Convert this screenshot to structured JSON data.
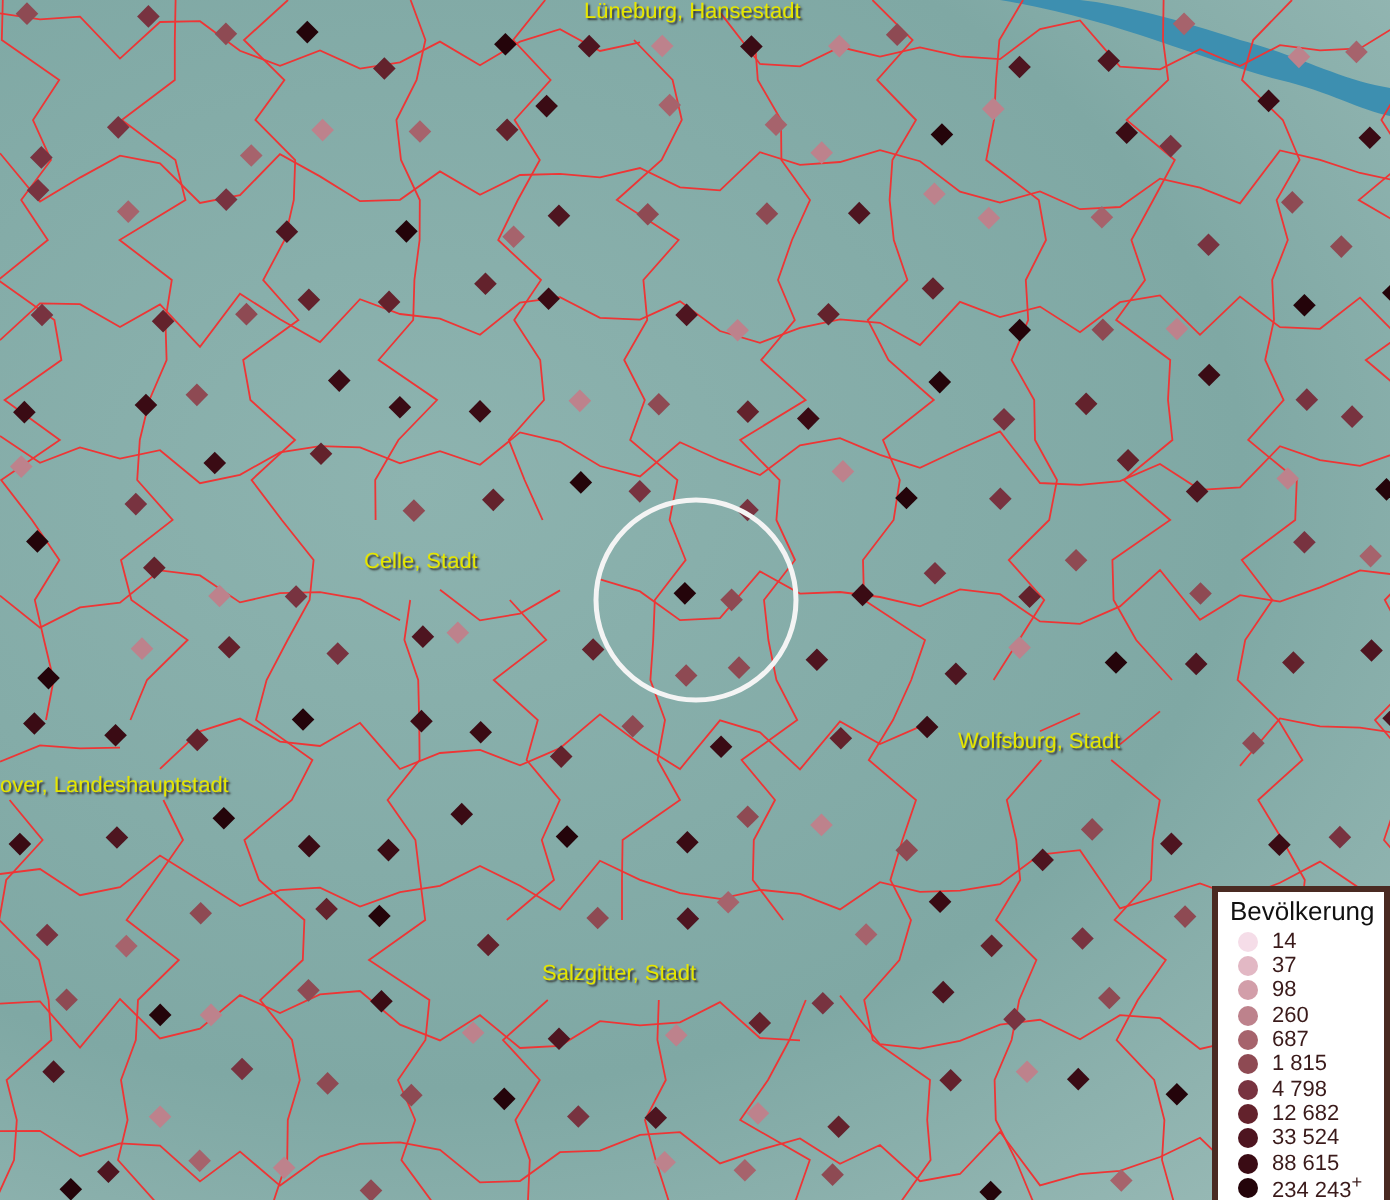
{
  "map": {
    "places": [
      {
        "name": "Lüneburg, Hansestadt"
      },
      {
        "name": "Celle, Stadt"
      },
      {
        "name": "over, Landeshauptstadt"
      },
      {
        "name": "Wolfsburg, Stadt"
      },
      {
        "name": "Salzgitter, Stadt"
      }
    ]
  },
  "legend": {
    "title": "Bevölkerung",
    "items": [
      {
        "label": "14",
        "color": "#f5dde8"
      },
      {
        "label": "37",
        "color": "#e2b8c4"
      },
      {
        "label": "98",
        "color": "#d29ea9"
      },
      {
        "label": "260",
        "color": "#bd828c"
      },
      {
        "label": "687",
        "color": "#a6636c"
      },
      {
        "label": "1 815",
        "color": "#8e4a53"
      },
      {
        "label": "4 798",
        "color": "#783340"
      },
      {
        "label": "12 682",
        "color": "#63222c"
      },
      {
        "label": "33 524",
        "color": "#4e1520"
      },
      {
        "label": "88 615",
        "color": "#3a0b14"
      },
      {
        "label": "234 243$^{+}$",
        "color": "#24040a"
      }
    ]
  }
}
